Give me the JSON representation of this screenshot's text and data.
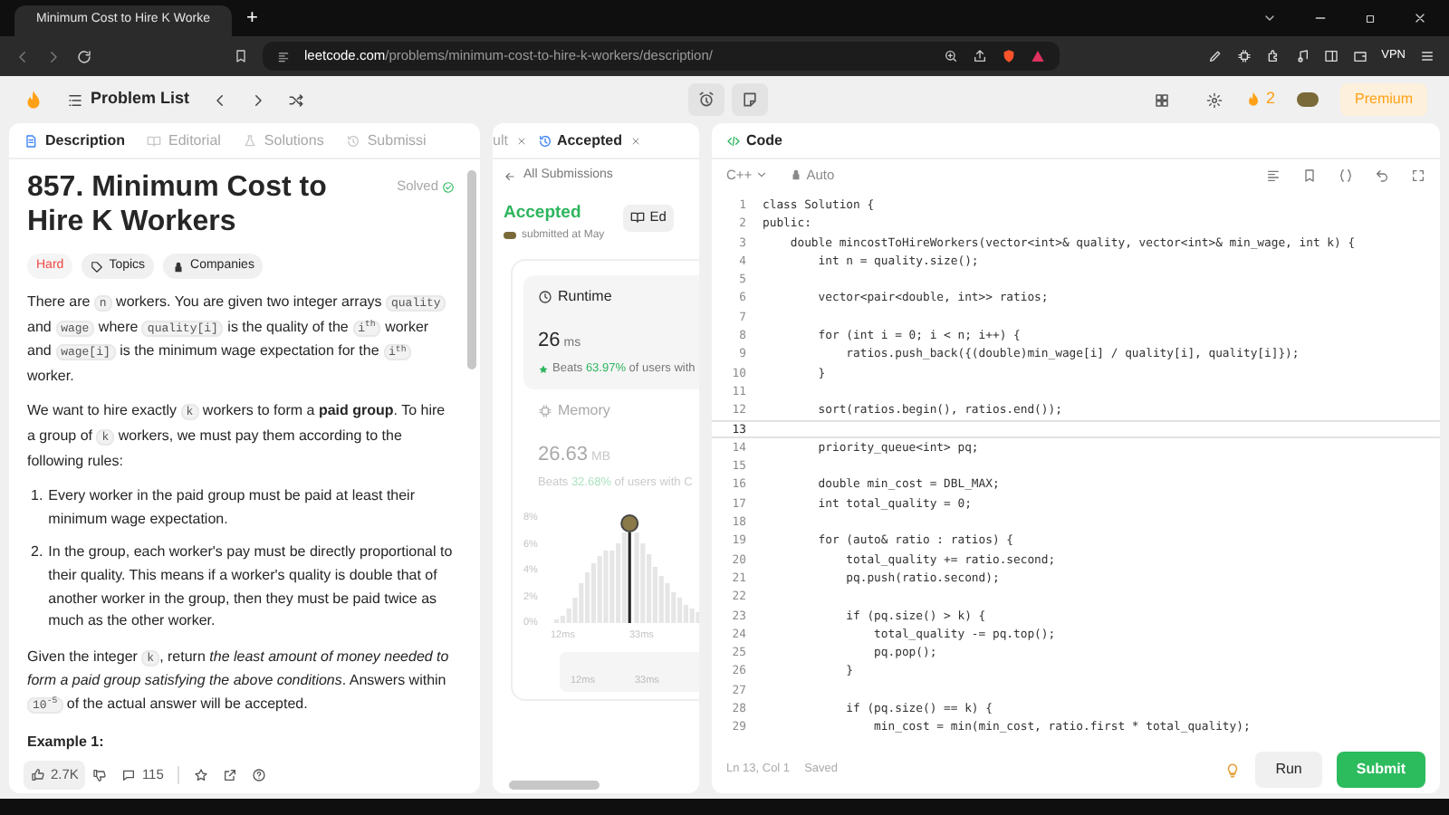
{
  "browser": {
    "tab_title": "Minimum Cost to Hire K Worke",
    "new_tab": "+",
    "url_host": "leetcode.com",
    "url_path": "/problems/minimum-cost-to-hire-k-workers/description/",
    "vpn": "VPN"
  },
  "header": {
    "problem_list": "Problem List",
    "streak": "2",
    "premium": "Premium"
  },
  "left_tabs": [
    {
      "label": "Description",
      "selected": true
    },
    {
      "label": "Editorial",
      "selected": false
    },
    {
      "label": "Solutions",
      "selected": false
    },
    {
      "label": "Submissi",
      "selected": false
    }
  ],
  "problem": {
    "title": "857. Minimum Cost to Hire K Workers",
    "status": "Solved",
    "difficulty": "Hard",
    "tags": [
      "Topics",
      "Companies"
    ],
    "paragraphs": [
      [
        {
          "kind": "text",
          "text": "There are "
        },
        {
          "kind": "code",
          "text": "n"
        },
        {
          "kind": "text",
          "text": " workers. You are given two integer arrays "
        },
        {
          "kind": "code",
          "text": "quality"
        },
        {
          "kind": "text",
          "text": " and "
        },
        {
          "kind": "code",
          "text": "wage"
        },
        {
          "kind": "text",
          "text": " where "
        },
        {
          "kind": "code",
          "text": "quality[i]"
        },
        {
          "kind": "text",
          "text": " is the quality of the "
        },
        {
          "kind": "code",
          "text": "i$^{th}$"
        },
        {
          "kind": "text",
          "text": " worker and "
        },
        {
          "kind": "code",
          "text": "wage[i]"
        },
        {
          "kind": "text",
          "text": " is the minimum wage expectation for the "
        },
        {
          "kind": "code",
          "text": "i$^{th}$"
        },
        {
          "kind": "text",
          "text": " worker."
        }
      ],
      [
        {
          "kind": "text",
          "text": "We want to hire exactly "
        },
        {
          "kind": "code",
          "text": "k"
        },
        {
          "kind": "text",
          "text": " workers to form a **paid group**. To hire a group of "
        },
        {
          "kind": "code",
          "text": "k"
        },
        {
          "kind": "text",
          "text": " workers, we must pay them according to the following rules:"
        }
      ]
    ],
    "rules": [
      {
        "number": "1.",
        "text": "Every worker in the paid group must be paid at least their minimum wage expectation."
      },
      {
        "number": "2.",
        "text": "In the group, each worker's pay must be directly proportional to their quality. This means if a worker's quality is double that of another worker in the group, then they must be paid twice as much as the other worker."
      }
    ],
    "closing": [
      {
        "kind": "text",
        "text": "Given the integer "
      },
      {
        "kind": "code",
        "text": "k"
      },
      {
        "kind": "text",
        "text": ", return *the least amount of money needed to form a paid group satisfying the above conditions*. Answers within "
      },
      {
        "kind": "code",
        "text": "10$^{-5}$"
      },
      {
        "kind": "text",
        "text": " of the actual answer will be accepted."
      }
    ],
    "example_heading": "Example 1:"
  },
  "left_footer": {
    "likes": "2.7K",
    "comments": "115"
  },
  "middle_tabs": [
    {
      "label": "ult",
      "selected": false
    },
    {
      "label": "Accepted",
      "selected": true
    }
  ],
  "submission": {
    "back": "All Submissions",
    "verdict": "Accepted",
    "submitted": "submitted at May",
    "editorial_button": "Ed",
    "metrics": [
      {
        "title": "Runtime",
        "value": "26",
        "unit": "ms",
        "beats_label": "Beats",
        "beats": "63.97%",
        "rest": "of users with",
        "selected": true
      },
      {
        "title": "Memory",
        "value": "26.63",
        "unit": "MB",
        "beats_label": "Beats",
        "beats": "32.68%",
        "rest": "of users with C",
        "selected": false
      }
    ],
    "histogram_y_labels": [
      "8%",
      "6%",
      "4%",
      "2%",
      "0%"
    ],
    "histogram_x_labels": [
      "12ms",
      "33ms"
    ],
    "overview_labels": [
      "12ms",
      "33ms"
    ]
  },
  "code_panel": {
    "title": "Code",
    "language": "C++",
    "mode": "Auto",
    "lines": [
      {
        "number": "1",
        "text": "class Solution {",
        "current": false
      },
      {
        "number": "2",
        "text": "public:",
        "current": false
      },
      {
        "number": "3",
        "text": "    double mincostToHireWorkers(vector<int>& quality, vector<int>& min_wage, int k) {",
        "current": false
      },
      {
        "number": "4",
        "text": "        int n = quality.size();",
        "current": false
      },
      {
        "number": "5",
        "current": false
      },
      {
        "number": "6",
        "text": "        vector<pair<double, int>> ratios;",
        "current": false
      },
      {
        "number": "7",
        "current": false
      },
      {
        "number": "8",
        "text": "        for (int i = 0; i < n; i++) {",
        "current": false
      },
      {
        "number": "9",
        "text": "            ratios.push_back({(double)min_wage[i] / quality[i], quality[i]});",
        "current": false
      },
      {
        "number": "10",
        "text": "        }",
        "current": false
      },
      {
        "number": "11",
        "current": false
      },
      {
        "number": "12",
        "text": "        sort(ratios.begin(), ratios.end());",
        "current": false
      },
      {
        "number": "13",
        "current": true
      },
      {
        "number": "14",
        "text": "        priority_queue<int> pq;",
        "current": false
      },
      {
        "number": "15",
        "current": false
      },
      {
        "number": "16",
        "text": "        double min_cost = DBL_MAX;",
        "current": false
      },
      {
        "number": "17",
        "text": "        int total_quality = 0;",
        "current": false
      },
      {
        "number": "18",
        "current": false
      },
      {
        "number": "19",
        "text": "        for (auto& ratio : ratios) {",
        "current": false
      },
      {
        "number": "20",
        "text": "            total_quality += ratio.second;",
        "current": false
      },
      {
        "number": "21",
        "text": "            pq.push(ratio.second);",
        "current": false
      },
      {
        "number": "22",
        "current": false
      },
      {
        "number": "23",
        "text": "            if (pq.size() > k) {",
        "current": false
      },
      {
        "number": "24",
        "text": "                total_quality -= pq.top();",
        "current": false
      },
      {
        "number": "25",
        "text": "                pq.pop();",
        "current": false
      },
      {
        "number": "26",
        "text": "            }",
        "current": false
      },
      {
        "number": "27",
        "current": false
      },
      {
        "number": "28",
        "text": "            if (pq.size() == k) {",
        "current": false
      },
      {
        "number": "29",
        "text": "                min_cost = min(min_cost, ratio.first * total_quality);",
        "current": false
      }
    ],
    "position": "Ln 13, Col 1",
    "saved": "Saved",
    "run": "Run",
    "submit": "Submit"
  }
}
